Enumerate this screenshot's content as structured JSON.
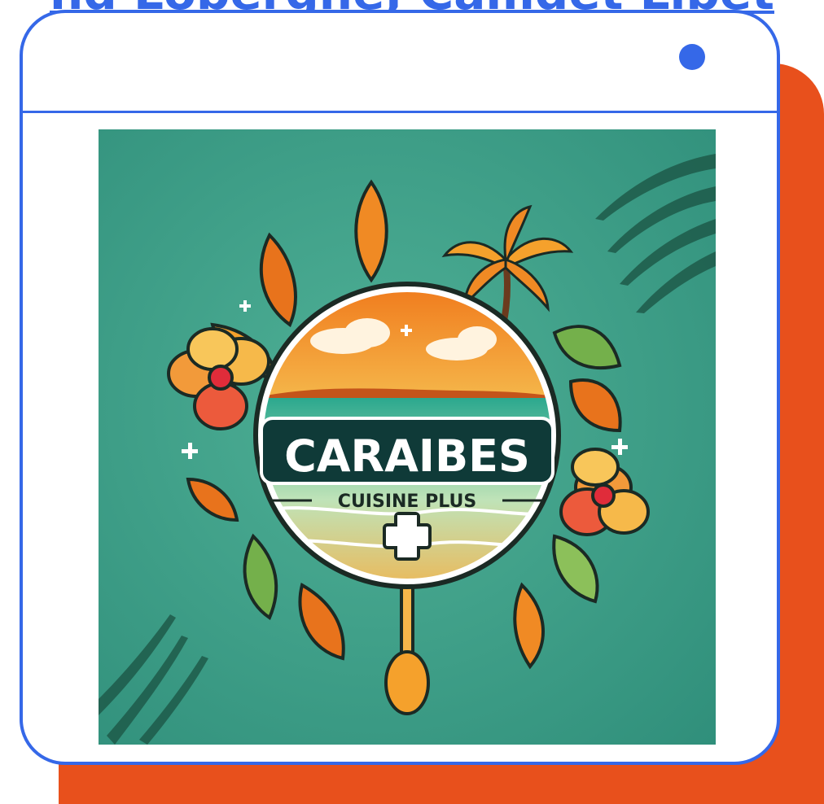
{
  "header": {
    "partial_text": "nd Loberghe, Camdet Libet"
  },
  "logo": {
    "brand_name": "CARAIBES",
    "tagline": "CUISINE PLUS"
  },
  "colors": {
    "accent_blue": "#3568E8",
    "shadow_orange": "#E8501C",
    "logo_background": "#3C9E88"
  }
}
